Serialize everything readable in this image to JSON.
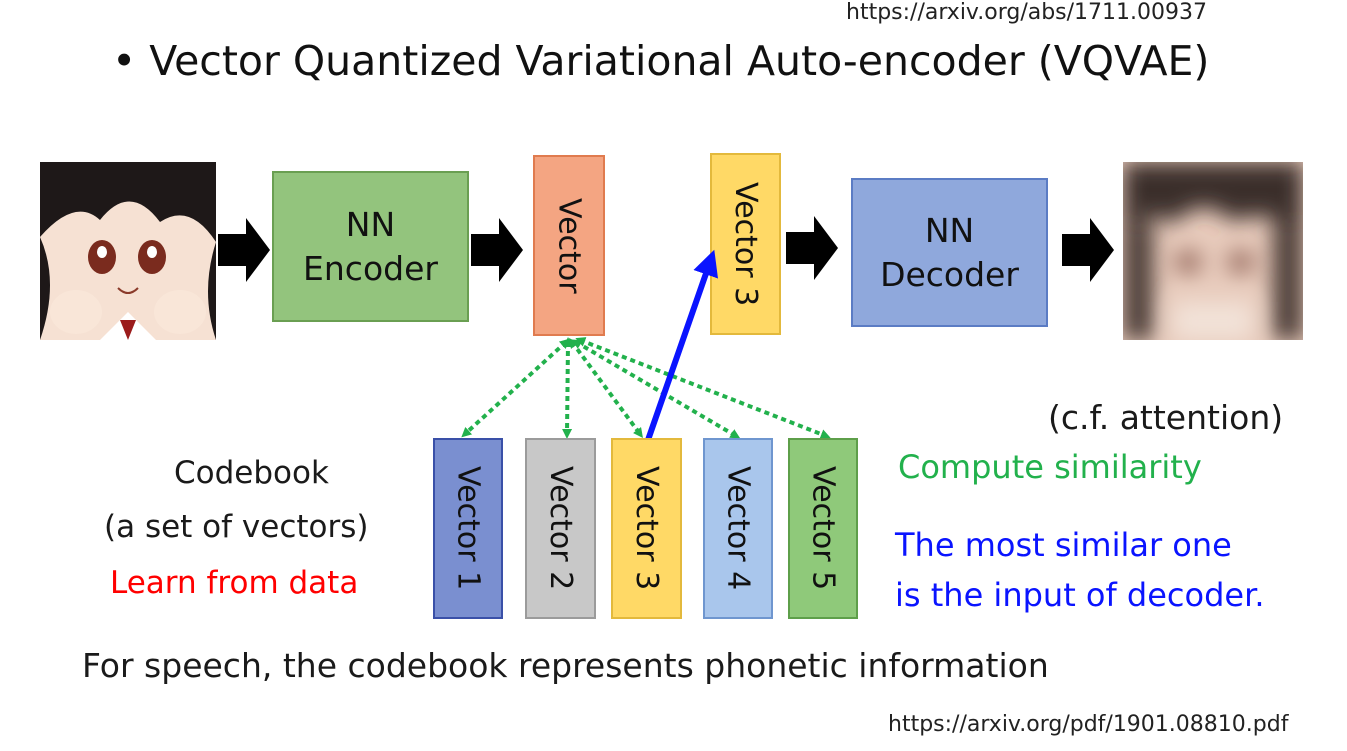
{
  "source_top": "https://arxiv.org/abs/1711.00937",
  "source_bottom": "https://arxiv.org/pdf/1901.08810.pdf",
  "title": "• Vector Quantized Variational Auto-encoder (VQVAE)",
  "encoder": {
    "line1": "NN",
    "line2": "Encoder"
  },
  "decoder": {
    "line1": "NN",
    "line2": "Decoder"
  },
  "encoded_vector": "Vector",
  "selected_vector": "Vector 3",
  "codebook": {
    "title": "Codebook",
    "subtitle": "(a set of vectors)",
    "note": "Learn from data",
    "vectors": [
      "Vector 1",
      "Vector 2",
      "Vector 3",
      "Vector 4",
      "Vector 5"
    ]
  },
  "annotations": {
    "cf": "(c.f. attention)",
    "similarity": "Compute similarity",
    "most_similar_1": "The most similar one",
    "most_similar_2": "is the input of decoder."
  },
  "footer": "For speech, the codebook represents phonetic information",
  "colors": {
    "encoder_fill": "#93c47d",
    "encoder_border": "#6a9f52",
    "decoder_fill": "#8fa8dc",
    "decoder_border": "#5b7cc4",
    "vector_fill": "#f4a582",
    "vector_border": "#e07b4f",
    "v1_fill": "#7a8fd0",
    "v2_fill": "#c8c8c8",
    "v3_fill": "#ffd966",
    "v4_fill": "#a9c6ec",
    "v5_fill": "#8fc97a",
    "similarity_green": "#22b14c",
    "selection_blue": "#0a14ff",
    "learn_red": "#ff0000"
  }
}
